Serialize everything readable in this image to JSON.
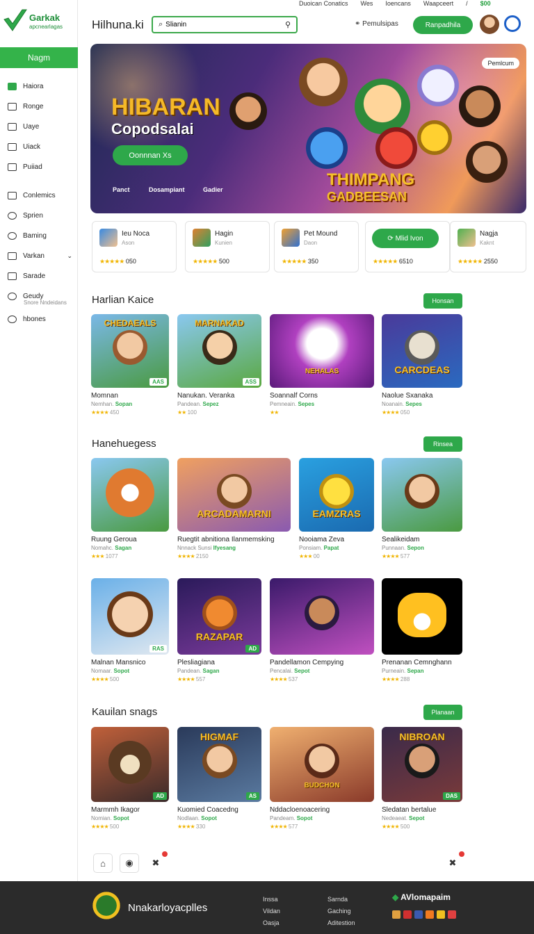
{
  "topbar": {
    "links": [
      "Duoican Conatics",
      "Wes",
      "Ioencans",
      "Waapceert",
      "/",
      "$00"
    ]
  },
  "sidebar": {
    "logo_title": "Garkak",
    "logo_subtitle": "apcnearlagas",
    "active_label": "Nagm",
    "items": [
      {
        "label": "Haiora",
        "icon": "controller-icon"
      },
      {
        "label": "Ronge",
        "icon": "box-icon"
      },
      {
        "label": "Uaye",
        "icon": "book-icon"
      },
      {
        "label": "Uiack",
        "icon": "chart-icon"
      },
      {
        "label": "Puiiad",
        "icon": "mail-icon"
      },
      {
        "label": "Conlemics",
        "icon": "list-icon"
      },
      {
        "label": "Sprien",
        "icon": "person-icon"
      },
      {
        "label": "Baming",
        "icon": "clock-icon"
      },
      {
        "label": "Varkan",
        "icon": "pencil-icon"
      },
      {
        "label": "Sarade",
        "icon": "grid-icon"
      },
      {
        "label": "Geudy",
        "icon": "circle-icon"
      },
      {
        "label": "hbones",
        "icon": "settings-icon"
      }
    ],
    "geudy_sub": "Snore Nndeidans"
  },
  "header": {
    "title": "Hilhuna.ki",
    "search_value": "Slianin",
    "link": "Pemulsipas",
    "button": "Ranpadhila"
  },
  "hero": {
    "title": "HIBARAN",
    "subtitle": "Copodsalai",
    "cta": "Oonnnan Xs",
    "labels": [
      "Panct",
      "Dosampiant",
      "Gadier"
    ],
    "big_text_1": "THIMPANG",
    "big_text_2": "GADBEESAN",
    "tag": "Pemlcum"
  },
  "stats": [
    {
      "name": "Ieu Noca",
      "sub": "Ason",
      "rating": "050"
    },
    {
      "name": "Hagin",
      "sub": "Kunien",
      "rating": "500"
    },
    {
      "name": "Pet Mound",
      "sub": "Daon",
      "rating": "350"
    },
    {
      "button": "Mlid Ivon",
      "rating": "6510"
    },
    {
      "name": "Nagja",
      "sub": "Kaknt",
      "rating": "2550"
    }
  ],
  "sections": [
    {
      "title": "Harlian Kaice",
      "button": "Honsan",
      "cards": [
        {
          "image_text": "CHEDAEALS",
          "badge": "AAS",
          "name": "Momnan",
          "sub": "Nemhan.",
          "sub_tag": "Sopan",
          "rating": "450"
        },
        {
          "image_text": "MARNAKAD",
          "badge": "ASS",
          "name": "Nanukan. Veranka",
          "sub": "Pandean.",
          "sub_tag": "Sepez",
          "rating": "100"
        },
        {
          "image_text": "NEHALAS",
          "badge": "",
          "name": "Soannalf Corns",
          "sub": "Pemneain.",
          "sub_tag": "Sepes",
          "rating": ""
        },
        {
          "image_text": "CARCDEAS",
          "badge": "",
          "name": "Naolue Sxanaka",
          "sub": "Noanain.",
          "sub_tag": "Sepes",
          "rating": "050"
        }
      ]
    },
    {
      "title": "Hanehuegess",
      "button": "Rinsea",
      "cards": [
        {
          "image_text": "",
          "badge": "",
          "name": "Ruung Geroua",
          "sub": "Nomahc.",
          "sub_tag": "Sagan",
          "rating": "1077"
        },
        {
          "image_text": "ARCADAMARNI",
          "badge": "",
          "name": "Ruegtit abnitiona Ilanmemsking",
          "sub": "Nnnack Sunsi",
          "sub_tag": "Ifyesang",
          "rating": "2150"
        },
        {
          "image_text": "EAMZRAS",
          "badge": "",
          "name": "Nooiama Zeva",
          "sub": "Ponsiam.",
          "sub_tag": "Papat",
          "rating": "00"
        },
        {
          "image_text": "",
          "badge": "",
          "name": "Sealikeidam",
          "sub": "Punnaan.",
          "sub_tag": "Sepon",
          "rating": "577"
        }
      ]
    },
    {
      "title": "",
      "button": "",
      "cards": [
        {
          "image_text": "",
          "badge": "RAS",
          "name": "Malnan Mansnico",
          "sub": "Nomaar.",
          "sub_tag": "Sopot",
          "rating": "500"
        },
        {
          "image_text": "RAZAPAR",
          "badge": "AD",
          "name": "Plesliagiana",
          "sub": "Pandean.",
          "sub_tag": "Sagan",
          "rating": "557"
        },
        {
          "image_text": "",
          "badge": "",
          "name": "Pandellamon Cempying",
          "sub": "Pencalai.",
          "sub_tag": "Sepot",
          "rating": "537"
        },
        {
          "image_text": "",
          "badge": "",
          "name": "Prenanan Cemnghann",
          "sub": "Purneain.",
          "sub_tag": "Sepan",
          "rating": "288"
        }
      ]
    },
    {
      "title": "Kauilan snags",
      "button": "Planaan",
      "cards": [
        {
          "image_text": "",
          "badge": "AD",
          "name": "Marmmh Ikagor",
          "sub": "Nomian.",
          "sub_tag": "Sopot",
          "rating": "500"
        },
        {
          "image_text": "HIGMAF",
          "badge": "AS",
          "name": "Kuomied Coacedng",
          "sub": "Nodlaan.",
          "sub_tag": "Sopot",
          "rating": "330"
        },
        {
          "image_text": "BUDCHON",
          "badge": "",
          "name": "Nddacloenoacering",
          "sub": "Pandeam.",
          "sub_tag": "Sopot",
          "rating": "577"
        },
        {
          "image_text": "NIBROAN",
          "badge": "DAS",
          "name": "Sledatan bertalue",
          "sub": "Nedeaeat.",
          "sub_tag": "Sepot",
          "rating": "500"
        }
      ]
    }
  ],
  "footer": {
    "name": "Nnakarloyacplles",
    "col1": [
      "Inssa",
      "Vildan",
      "Oasja"
    ],
    "col2": [
      "Sarnda",
      "Gaching",
      "Aditestion"
    ],
    "brand": "AVlomapaim"
  },
  "colors": {
    "accent": "#2ea84a",
    "footer": "#2b2b2b",
    "star": "#f0b400"
  }
}
